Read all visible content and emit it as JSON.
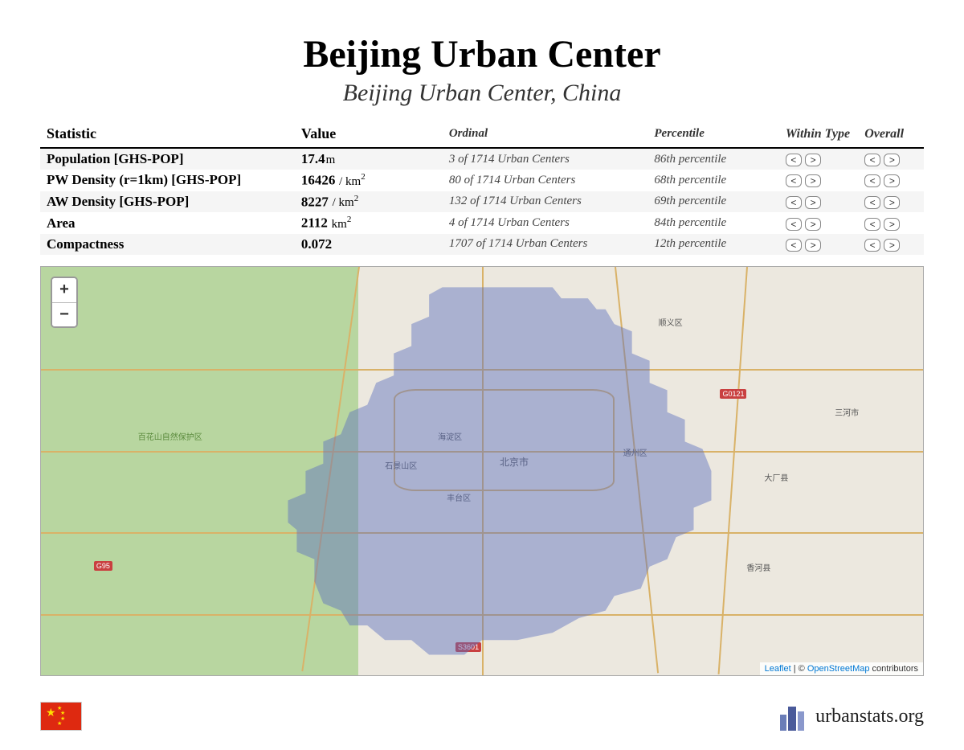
{
  "header": {
    "title": "Beijing Urban Center",
    "subtitle": "Beijing Urban Center, China"
  },
  "columns": {
    "stat": "Statistic",
    "value": "Value",
    "ordinal": "Ordinal",
    "percentile": "Percentile",
    "within": "Within Type",
    "overall": "Overall"
  },
  "rows": [
    {
      "stat": "Population [GHS-POP]",
      "value": "17.4",
      "unit": "m",
      "sup": "",
      "ordinal": "3 of 1714 Urban Centers",
      "percentile": "86th percentile",
      "shade": true
    },
    {
      "stat": "PW Density (r=1km) [GHS-POP]",
      "value": "16426",
      "unit": " / km",
      "sup": "2",
      "ordinal": "80 of 1714 Urban Centers",
      "percentile": "68th percentile",
      "shade": false
    },
    {
      "stat": "AW Density [GHS-POP]",
      "value": "8227",
      "unit": " / km",
      "sup": "2",
      "ordinal": "132 of 1714 Urban Centers",
      "percentile": "69th percentile",
      "shade": true
    },
    {
      "stat": "Area",
      "value": "2112",
      "unit": " km",
      "sup": "2",
      "ordinal": "4 of 1714 Urban Centers",
      "percentile": "84th percentile",
      "shade": false
    },
    {
      "stat": "Compactness",
      "value": "0.072",
      "unit": "",
      "sup": "",
      "ordinal": "1707 of 1714 Urban Centers",
      "percentile": "12th percentile",
      "shade": true
    }
  ],
  "nav": {
    "prev": "<",
    "next": ">"
  },
  "map": {
    "zoom_in": "+",
    "zoom_out": "−",
    "attribution_leaflet": "Leaflet",
    "attribution_sep": " | © ",
    "attribution_osm": "OpenStreetMap",
    "attribution_tail": " contributors",
    "labels": {
      "park": "百花山自然保护区",
      "beijing": "北京市",
      "haidian": "海淀区",
      "fengtai": "丰台区",
      "shijingshan": "石景山区",
      "tongzhou": "通州区",
      "shunyi": "顺义区",
      "sanhe": "三河市",
      "dachang": "大厂县",
      "xianghe": "香河县",
      "g95": "G95",
      "g0121": "G0121",
      "s3601": "S3601"
    }
  },
  "footer": {
    "site": "urbanstats.org",
    "country": "China"
  }
}
